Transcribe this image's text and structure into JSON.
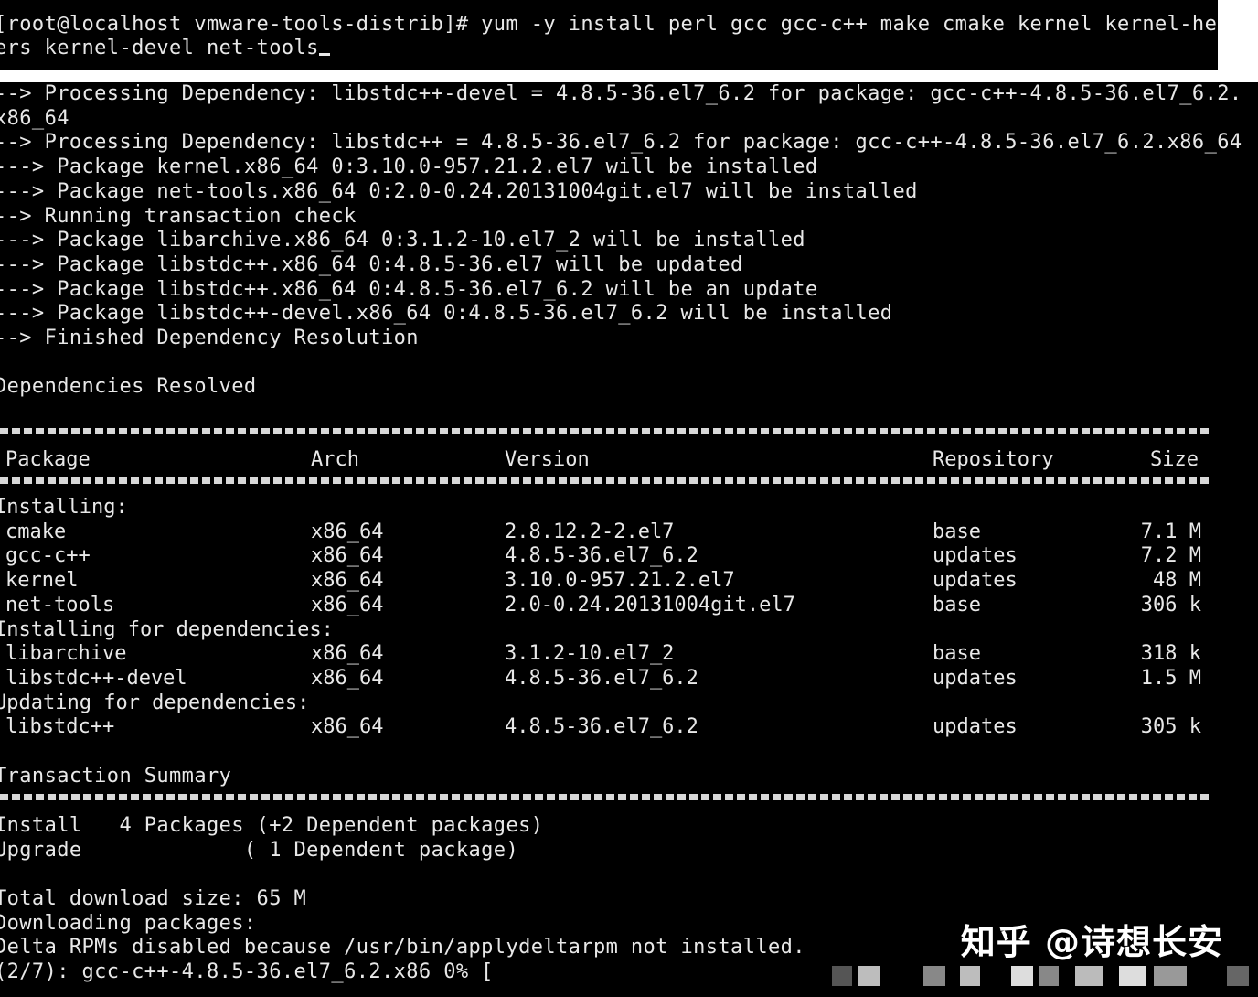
{
  "command": {
    "line1": "[root@localhost vmware-tools-distrib]# yum -y install perl gcc gcc-c++ make cmake kernel kernel-head",
    "line2": "ers kernel-devel net-tools"
  },
  "log_lines": [
    "--> Processing Dependency: libstdc++-devel = 4.8.5-36.el7_6.2 for package: gcc-c++-4.8.5-36.el7_6.2.",
    "x86_64",
    "--> Processing Dependency: libstdc++ = 4.8.5-36.el7_6.2 for package: gcc-c++-4.8.5-36.el7_6.2.x86_64",
    "---> Package kernel.x86_64 0:3.10.0-957.21.2.el7 will be installed",
    "---> Package net-tools.x86_64 0:2.0-0.24.20131004git.el7 will be installed",
    "--> Running transaction check",
    "---> Package libarchive.x86_64 0:3.1.2-10.el7_2 will be installed",
    "---> Package libstdc++.x86_64 0:4.8.5-36.el7 will be updated",
    "---> Package libstdc++.x86_64 0:4.8.5-36.el7_6.2 will be an update",
    "---> Package libstdc++-devel.x86_64 0:4.8.5-36.el7_6.2 will be installed",
    "--> Finished Dependency Resolution",
    "",
    "Dependencies Resolved"
  ],
  "table": {
    "headers": [
      "Package",
      "Arch",
      "Version",
      "Repository",
      "Size"
    ],
    "rows": [
      {
        "kind": "section",
        "text": "Installing:"
      },
      {
        "kind": "pkg",
        "cells": [
          "cmake",
          "x86_64",
          "2.8.12.2-2.el7",
          "base",
          "7.1 M"
        ]
      },
      {
        "kind": "pkg",
        "cells": [
          "gcc-c++",
          "x86_64",
          "4.8.5-36.el7_6.2",
          "updates",
          "7.2 M"
        ]
      },
      {
        "kind": "pkg",
        "cells": [
          "kernel",
          "x86_64",
          "3.10.0-957.21.2.el7",
          "updates",
          "48 M"
        ]
      },
      {
        "kind": "pkg",
        "cells": [
          "net-tools",
          "x86_64",
          "2.0-0.24.20131004git.el7",
          "base",
          "306 k"
        ]
      },
      {
        "kind": "section",
        "text": "Installing for dependencies:"
      },
      {
        "kind": "pkg",
        "cells": [
          "libarchive",
          "x86_64",
          "3.1.2-10.el7_2",
          "base",
          "318 k"
        ]
      },
      {
        "kind": "pkg",
        "cells": [
          "libstdc++-devel",
          "x86_64",
          "4.8.5-36.el7_6.2",
          "updates",
          "1.5 M"
        ]
      },
      {
        "kind": "section",
        "text": "Updating for dependencies:"
      },
      {
        "kind": "pkg",
        "cells": [
          "libstdc++",
          "x86_64",
          "4.8.5-36.el7_6.2",
          "updates",
          "305 k"
        ]
      }
    ]
  },
  "summary": {
    "title": "Transaction Summary",
    "install": "Install   4 Packages (+2 Dependent packages)",
    "upgrade": "Upgrade             ( 1 Dependent package)"
  },
  "footer_lines": [
    "Total download size: 65 M",
    "Downloading packages:",
    "Delta RPMs disabled because /usr/bin/applydeltarpm not installed.",
    "(2/7): gcc-c++-4.8.5-36.el7_6.2.x86 0% ["
  ],
  "watermark": "知乎 @诗想长安",
  "colors": {
    "background": "#000000",
    "text": "#e8e8e8",
    "page": "#ffffff"
  }
}
